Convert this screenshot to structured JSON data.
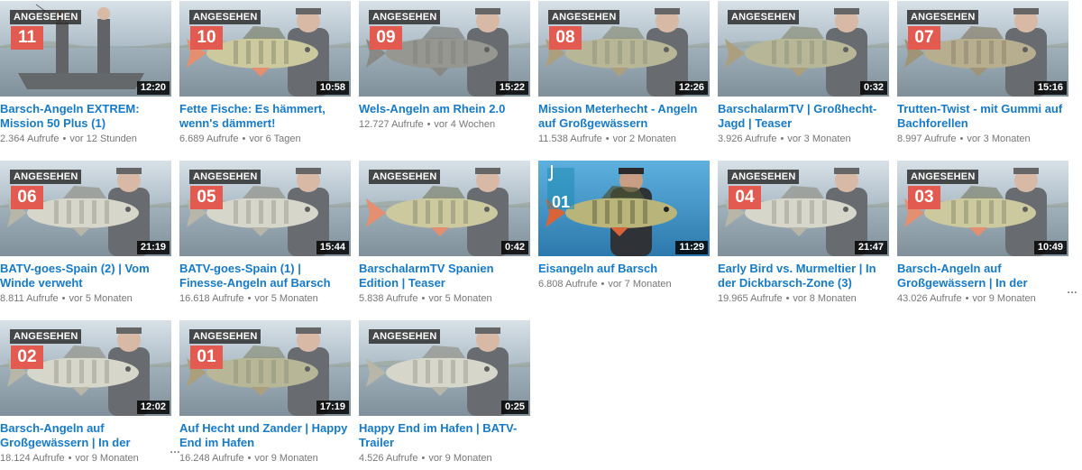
{
  "watched_badge": "ANGESEHEN",
  "colors": {
    "title_link": "#167ac6",
    "meta_text": "#767676",
    "episode_badge": "#e35a50",
    "duration_bg": "#000000"
  },
  "icons": {
    "episode": "bookmark-ribbon-icon",
    "hook": "fishing-hook-icon",
    "more": "ellipsis-icon"
  },
  "videos": [
    {
      "episode": "11",
      "watched": true,
      "duration": "12:20",
      "title": "Barsch-Angeln EXTREM: Mission 50 Plus (1)",
      "views": "2.364 Aufrufe",
      "age": "vor 12 Stunden",
      "scene": "boat"
    },
    {
      "episode": "10",
      "watched": true,
      "duration": "10:58",
      "title": "Fette Fische: Es hämmert, wenn's dämmert!",
      "views": "6.689 Aufrufe",
      "age": "vor 6 Tagen",
      "scene": "perch"
    },
    {
      "episode": "09",
      "watched": true,
      "duration": "15:22",
      "title": "Wels-Angeln am Rhein 2.0",
      "views": "12.727 Aufrufe",
      "age": "vor 4 Wochen",
      "scene": "catfish"
    },
    {
      "episode": "08",
      "watched": true,
      "duration": "12:26",
      "title": "Mission Meterhecht - Angeln auf Großgewässern",
      "views": "11.538 Aufrufe",
      "age": "vor 2 Monaten",
      "scene": "pike"
    },
    {
      "episode": "",
      "watched": true,
      "duration": "0:32",
      "title": "BarschalarmTV | Großhecht-Jagd | Teaser",
      "views": "3.926 Aufrufe",
      "age": "vor 3 Monaten",
      "scene": "pike"
    },
    {
      "episode": "07",
      "watched": true,
      "duration": "15:16",
      "title": "Trutten-Twist - mit Gummi auf Bachforellen",
      "views": "8.997 Aufrufe",
      "age": "vor 3 Monaten",
      "scene": "trout"
    },
    {
      "episode": "06",
      "watched": true,
      "duration": "21:19",
      "title": "BATV-goes-Spain (2) | Vom Winde verweht",
      "views": "8.811 Aufrufe",
      "age": "vor 5 Monaten",
      "scene": "zander"
    },
    {
      "episode": "05",
      "watched": true,
      "duration": "15:44",
      "title": "BATV-goes-Spain (1) | Finesse-Angeln auf Barsch und Zander",
      "views": "16.618 Aufrufe",
      "age": "vor 5 Monaten",
      "scene": "zander"
    },
    {
      "episode": "",
      "watched": true,
      "duration": "0:42",
      "title": "BarschalarmTV Spanien Edition | Teaser",
      "views": "5.838 Aufrufe",
      "age": "vor 5 Monaten",
      "scene": "perch"
    },
    {
      "episode": "01",
      "watched": false,
      "hook": true,
      "duration": "11:29",
      "title": "Eisangeln auf Barsch",
      "views": "6.808 Aufrufe",
      "age": "vor 7 Monaten",
      "scene": "ice"
    },
    {
      "episode": "04",
      "watched": true,
      "duration": "21:47",
      "title": "Early Bird vs. Murmeltier | In der Dickbarsch-Zone (3)",
      "views": "19.965 Aufrufe",
      "age": "vor 8 Monaten",
      "scene": "zander"
    },
    {
      "episode": "03",
      "watched": true,
      "duration": "10:49",
      "title": "Barsch-Angeln auf Großgewässern | In der",
      "views": "43.026 Aufrufe",
      "age": "vor 9 Monaten",
      "scene": "perch",
      "more": "…"
    },
    {
      "episode": "02",
      "watched": true,
      "duration": "12:02",
      "title": "Barsch-Angeln auf Großgewässern | In der",
      "views": "18.124 Aufrufe",
      "age": "vor 9 Monaten",
      "scene": "zander",
      "more": "…"
    },
    {
      "episode": "01",
      "watched": true,
      "duration": "17:19",
      "title": "Auf Hecht und Zander | Happy End im Hafen",
      "views": "16.248 Aufrufe",
      "age": "vor 9 Monaten",
      "scene": "pike"
    },
    {
      "episode": "",
      "watched": true,
      "duration": "0:25",
      "title": "Happy End im Hafen | BATV-Trailer",
      "views": "4.526 Aufrufe",
      "age": "vor 9 Monaten",
      "scene": "zander"
    }
  ]
}
